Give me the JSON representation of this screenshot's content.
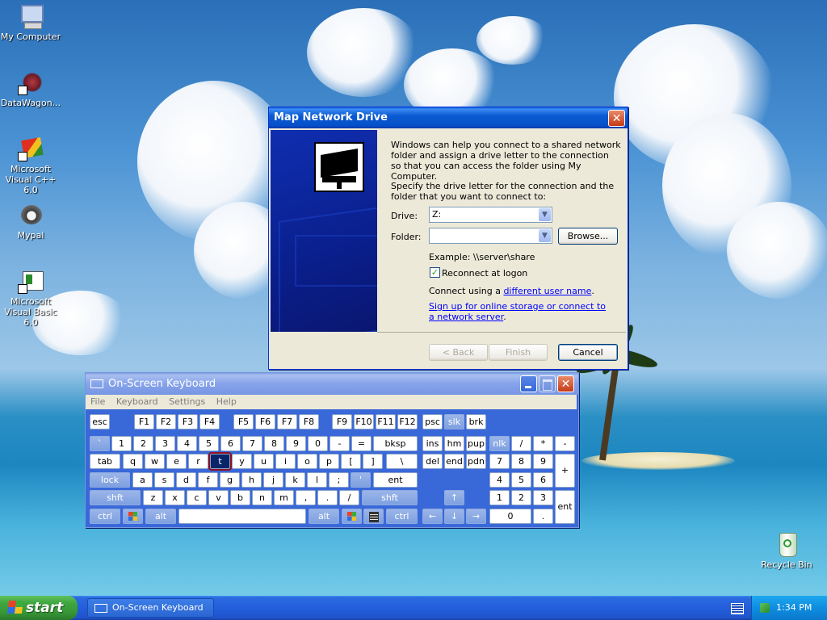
{
  "desktop": {
    "icons": [
      {
        "label": "My Computer"
      },
      {
        "label": "DataWagon..."
      },
      {
        "label": "Microsoft Visual C++ 6.0"
      },
      {
        "label": "Mypal"
      },
      {
        "label": "Microsoft Visual Basic 6.0"
      },
      {
        "label": "Recycle Bin"
      }
    ]
  },
  "map_dialog": {
    "title": "Map Network Drive",
    "intro": "Windows can help you connect to a shared network folder and assign a drive letter to the connection so that you can access the folder using My Computer.",
    "instruction": "Specify the drive letter for the connection and the folder that you want to connect to:",
    "drive_label": "Drive:",
    "drive_value": "Z:",
    "folder_label": "Folder:",
    "folder_value": "",
    "browse_label": "Browse...",
    "example": "Example: \\\\server\\share",
    "reconnect_label": "Reconnect at logon",
    "reconnect_checked": true,
    "connect_prefix": "Connect using a ",
    "connect_link": "different user name",
    "connect_suffix": ".",
    "signup_link": "Sign up for online storage or connect to a network server",
    "signup_suffix": ".",
    "back_label": "< Back",
    "finish_label": "Finish",
    "cancel_label": "Cancel"
  },
  "osk": {
    "title": "On-Screen Keyboard",
    "menu": [
      "File",
      "Keyboard",
      "Settings",
      "Help"
    ],
    "row0": [
      "esc",
      "F1",
      "F2",
      "F3",
      "F4",
      "F5",
      "F6",
      "F7",
      "F8",
      "F9",
      "F10",
      "F11",
      "F12",
      "psc",
      "slk",
      "brk"
    ],
    "row1": [
      "`",
      "1",
      "2",
      "3",
      "4",
      "5",
      "6",
      "7",
      "8",
      "9",
      "0",
      "-",
      "=",
      "bksp",
      "ins",
      "hm",
      "pup",
      "nlk",
      "/",
      "*",
      "-"
    ],
    "row2": [
      "tab",
      "q",
      "w",
      "e",
      "r",
      "t",
      "y",
      "u",
      "i",
      "o",
      "p",
      "[",
      "]",
      "\\",
      "del",
      "end",
      "pdn",
      "7",
      "8",
      "9",
      "+"
    ],
    "row3": [
      "lock",
      "a",
      "s",
      "d",
      "f",
      "g",
      "h",
      "j",
      "k",
      "l",
      ";",
      "'",
      "ent",
      "4",
      "5",
      "6"
    ],
    "row4": [
      "shft",
      "z",
      "x",
      "c",
      "v",
      "b",
      "n",
      "m",
      ",",
      ".",
      "/",
      "shft",
      "↑",
      "1",
      "2",
      "3",
      "ent"
    ],
    "row5": [
      "ctrl",
      "alt",
      "alt",
      "ctrl",
      "←",
      "↓",
      "→",
      "0",
      "."
    ],
    "selected_key": "t"
  },
  "taskbar": {
    "start_label": "start",
    "task_label": "On-Screen Keyboard",
    "clock": "1:34 PM"
  }
}
